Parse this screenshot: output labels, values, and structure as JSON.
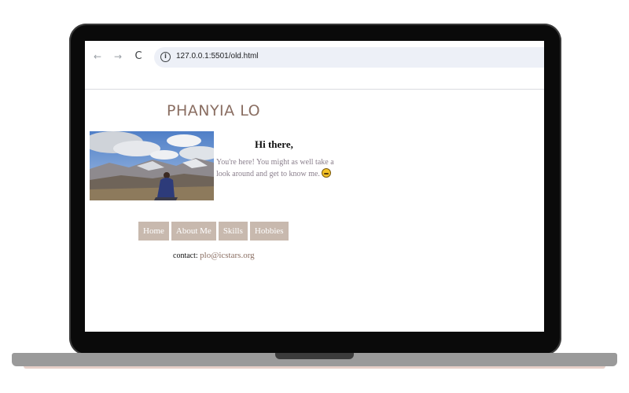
{
  "browser": {
    "url": "127.0.0.1:5501/old.html",
    "back_icon": "←",
    "forward_icon": "→",
    "reload_icon": "C",
    "info_icon": "i"
  },
  "page": {
    "title": "PHANYIA LO",
    "greeting": "Hi there,",
    "intro": "You're here! You might as well take a look around and get to know me.",
    "nav": [
      "Home",
      "About Me",
      "Skills",
      "Hobbies"
    ],
    "contact_label": "contact:",
    "contact_email": "plo@icstars.org"
  },
  "colors": {
    "title": "#8a6e62",
    "nav_bg": "#c8b9ae",
    "intro_text": "#8a7f8c",
    "address_bar": "#edf0f7"
  }
}
